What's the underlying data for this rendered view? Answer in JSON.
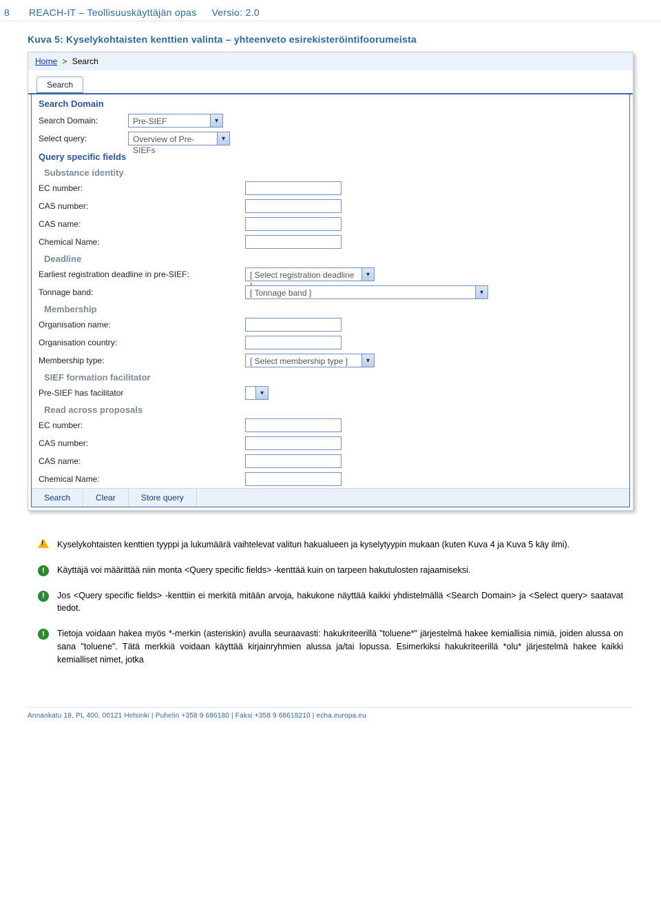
{
  "header": {
    "page_number": "8",
    "doc_title": "REACH-IT – Teollisuuskäyttäjän opas",
    "version_label": "Versio: 2.0"
  },
  "section_title": "Kuva 5: Kyselykohtaisten kenttien valinta – yhteenveto esirekisteröintifoorumeista",
  "screenshot": {
    "breadcrumb": {
      "home": "Home",
      "sep": ">",
      "current": "Search"
    },
    "tab_label": "Search",
    "group_search_domain": "Search Domain",
    "row_search_domain": {
      "label": "Search Domain:",
      "value": "Pre-SIEF"
    },
    "row_select_query": {
      "label": "Select query:",
      "value": "Overview of Pre-SIEFs"
    },
    "group_query_fields": "Query specific fields",
    "sub_substance": "Substance identity",
    "row_ec_number": "EC number:",
    "row_cas_number": "CAS number:",
    "row_cas_name": "CAS name:",
    "row_chemical_name": "Chemical Name:",
    "sub_deadline": "Deadline",
    "row_deadline": {
      "label": "Earliest registration deadline in pre-SIEF:",
      "value": "[ Select registration deadline ]"
    },
    "row_tonnage": {
      "label": "Tonnage band:",
      "value": "[ Tonnage band ]"
    },
    "sub_membership": "Membership",
    "row_org_name": "Organisation name:",
    "row_org_country": "Organisation country:",
    "row_membership_type": {
      "label": "Membership type:",
      "value": "[ Select membership type ]"
    },
    "sub_sief_facilitator": "SIEF formation facilitator",
    "row_has_facilitator": "Pre-SIEF has facilitator",
    "sub_read_across": "Read across proposals",
    "row_ec_number2": "EC number:",
    "row_cas_number2": "CAS number:",
    "row_cas_name2": "CAS name:",
    "row_chemical_name2": "Chemical Name:",
    "buttons": {
      "search": "Search",
      "clear": "Clear",
      "store": "Store query"
    }
  },
  "notes": {
    "n1": "Kyselykohtaisten kenttien tyyppi ja lukumäärä vaihtelevat valitun hakualueen ja kyselytyypin mukaan (kuten Kuva 4 ja Kuva 5 käy ilmi).",
    "n2": "Käyttäjä voi määrittää niin monta <Query specific fields> -kenttää kuin on tarpeen hakutulosten rajaamiseksi.",
    "n3": "Jos <Query specific fields> -kenttiin ei merkitä mitään arvoja, hakukone näyttää kaikki yhdistelmällä <Search Domain> ja <Select query> saatavat tiedot.",
    "n4": "Tietoja voidaan hakea myös *-merkin (asteriskin) avulla seuraavasti: hakukriteerillä \"toluene*\" järjestelmä hakee kemiallisia nimiä, joiden alussa on sana \"toluene\". Tätä merkkiä voidaan käyttää kirjainryhmien alussa ja/tai lopussa. Esimerkiksi hakukriteerillä *olu* järjestelmä hakee kaikki kemialliset nimet, jotka"
  },
  "footer": "Annankatu 18, PL 400, 00121 Helsinki | Puhelin +358 9 686180 | Faksi +358 9 68618210 | echa.europa.eu"
}
